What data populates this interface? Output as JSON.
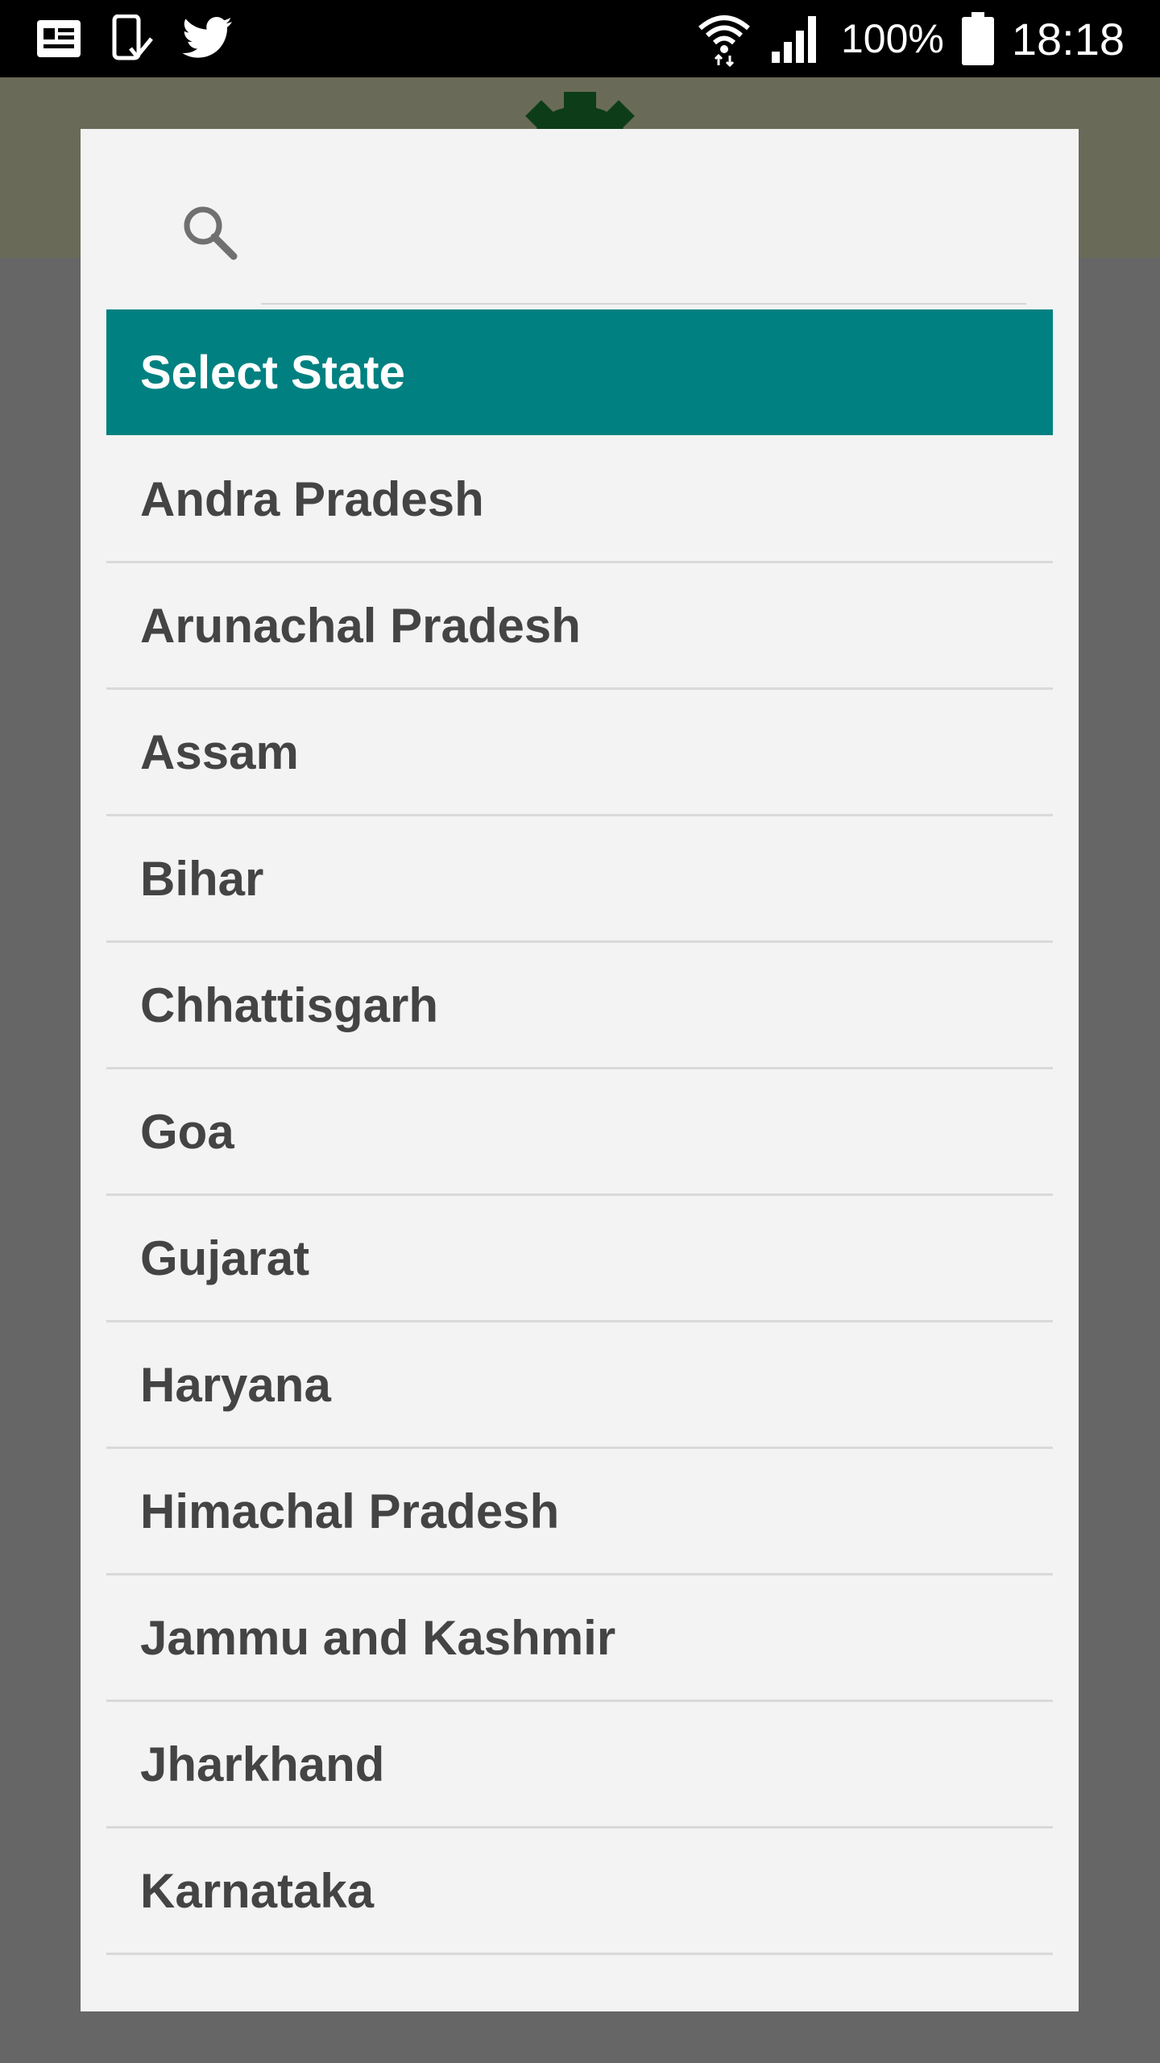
{
  "status_bar": {
    "left_icons": [
      "news-icon",
      "phone-check-icon",
      "twitter-icon"
    ],
    "battery_percent": "100%",
    "time": "18:18"
  },
  "dialog": {
    "search": {
      "value": "",
      "placeholder": ""
    },
    "title": "Select State",
    "items": [
      {
        "label": "Andra Pradesh"
      },
      {
        "label": "Arunachal Pradesh"
      },
      {
        "label": "Assam"
      },
      {
        "label": "Bihar"
      },
      {
        "label": "Chhattisgarh"
      },
      {
        "label": "Goa"
      },
      {
        "label": "Gujarat"
      },
      {
        "label": "Haryana"
      },
      {
        "label": "Himachal Pradesh"
      },
      {
        "label": "Jammu and Kashmir"
      },
      {
        "label": "Jharkhand"
      },
      {
        "label": "Karnataka"
      }
    ]
  },
  "colors": {
    "header": "#008080",
    "overlay": "#666666",
    "dialog_bg": "#f3f3f3",
    "text": "#444444"
  }
}
